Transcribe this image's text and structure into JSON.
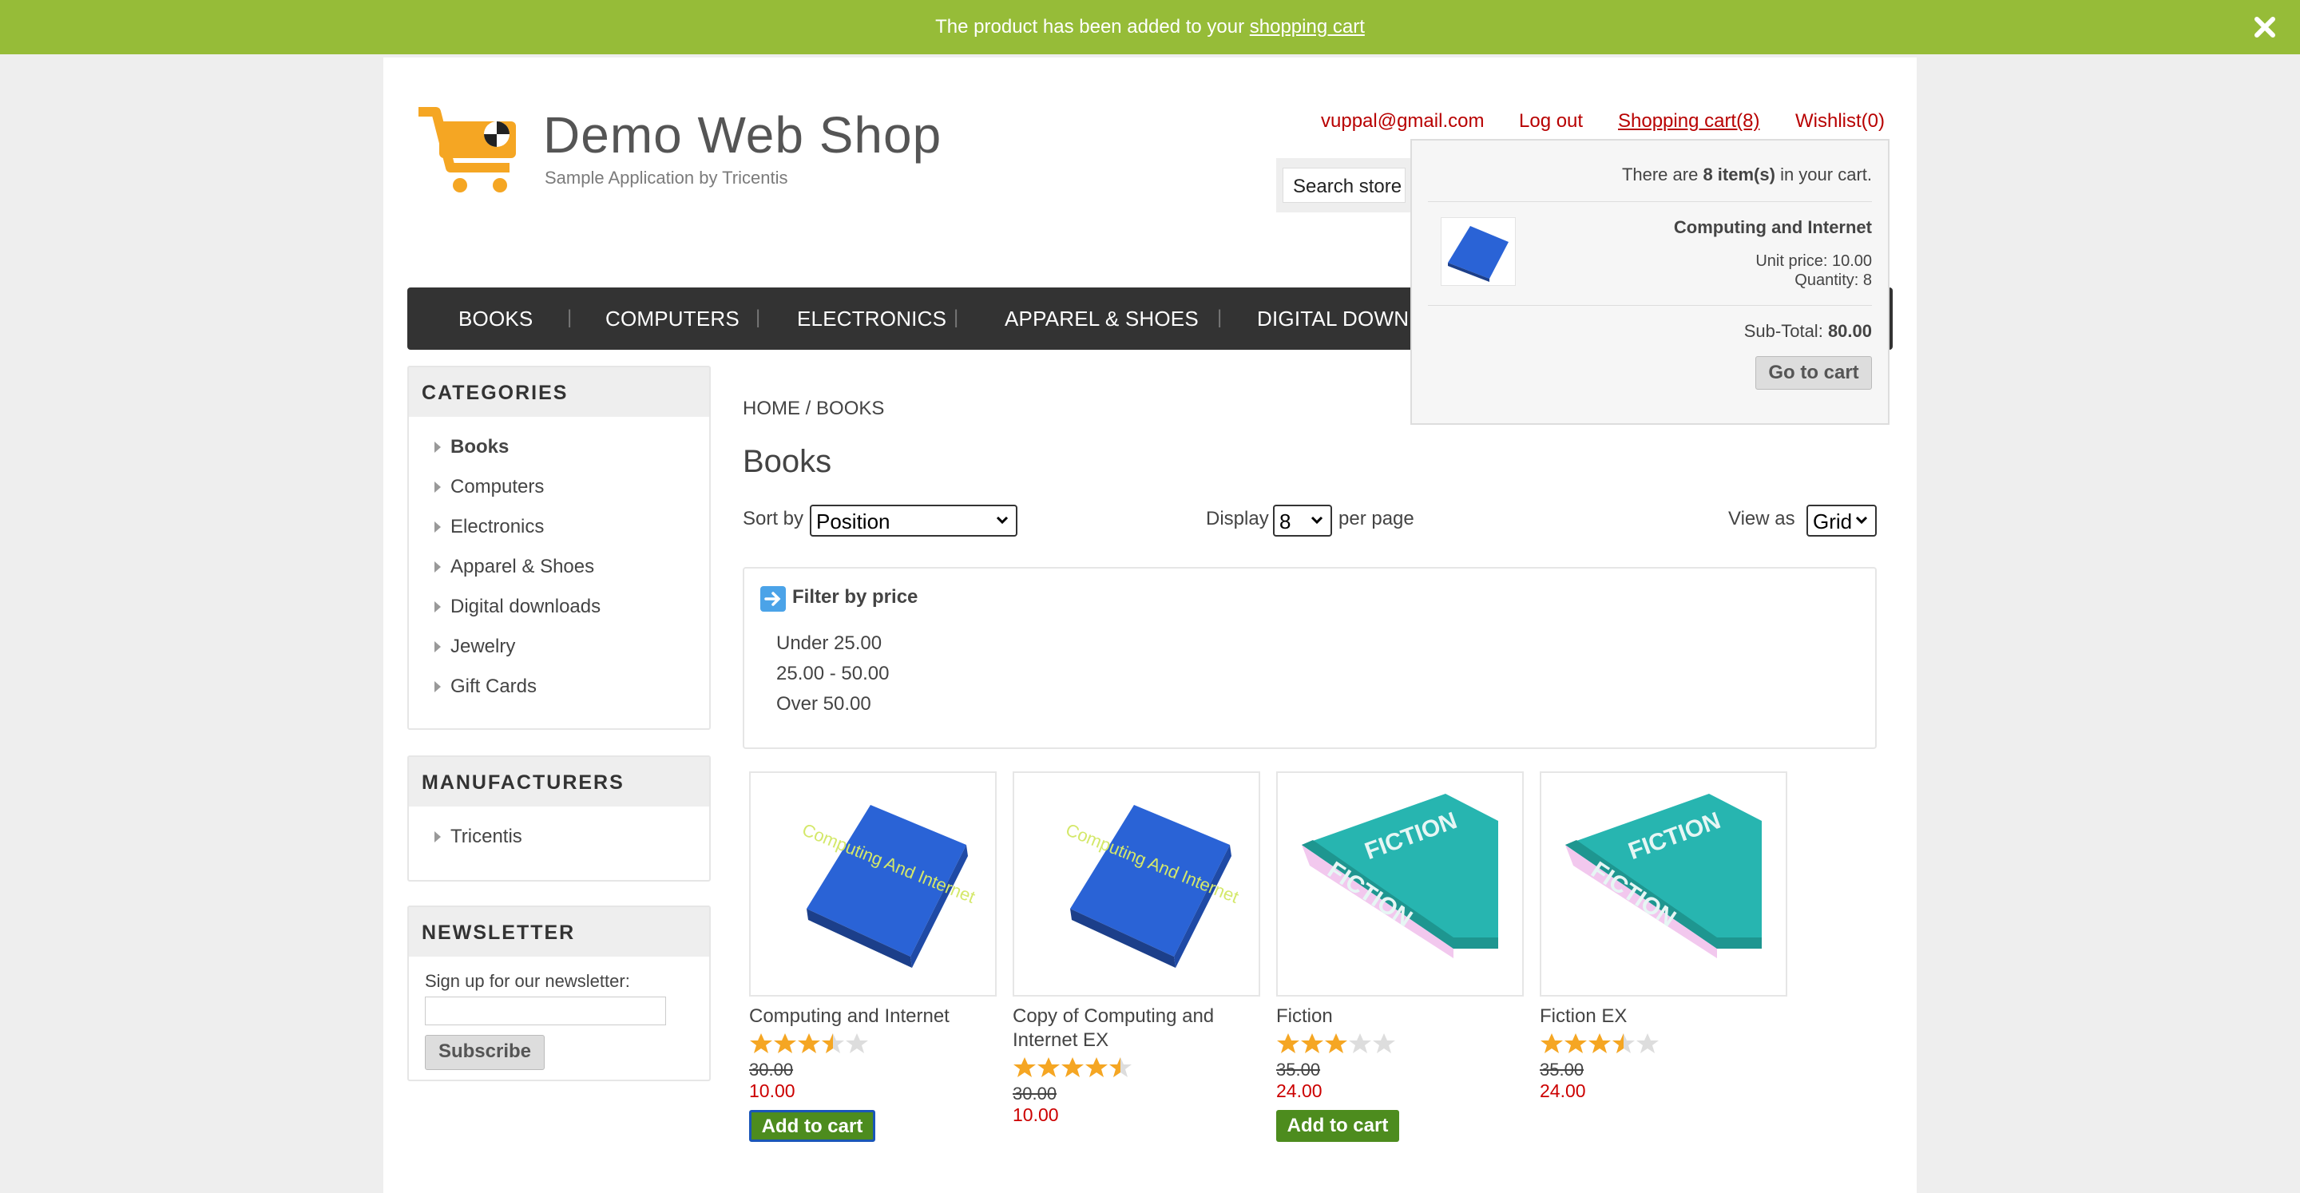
{
  "notification": {
    "message": "The product has been added to your",
    "link": "shopping cart"
  },
  "header": {
    "logo_title": "Demo Web Shop",
    "logo_subtitle": "Sample Application by Tricentis",
    "email": "vuppal@gmail.com",
    "logout": "Log out",
    "cart": "Shopping cart(8)",
    "wishlist": "Wishlist(0)",
    "search_placeholder": "Search store"
  },
  "menu": [
    "BOOKS",
    "COMPUTERS",
    "ELECTRONICS",
    "APPAREL & SHOES",
    "DIGITAL DOWN"
  ],
  "categories": {
    "title": "CATEGORIES",
    "items": [
      "Books",
      "Computers",
      "Electronics",
      "Apparel & Shoes",
      "Digital downloads",
      "Jewelry",
      "Gift Cards"
    ]
  },
  "manufacturers": {
    "title": "MANUFACTURERS",
    "items": [
      "Tricentis"
    ]
  },
  "newsletter": {
    "title": "NEWSLETTER",
    "label": "Sign up for our newsletter:",
    "button": "Subscribe"
  },
  "breadcrumb": {
    "home": "HOME",
    "sep": "/",
    "current": "BOOKS"
  },
  "page_title": "Books",
  "controls": {
    "sort_label": "Sort by",
    "sort_value": "Position",
    "display_label": "Display",
    "display_value": "8",
    "per_page": "per page",
    "view_label": "View as",
    "view_value": "Grid"
  },
  "filter": {
    "title": "Filter by price",
    "ranges": [
      "Under 25.00",
      "25.00 - 50.00",
      "Over 50.00"
    ]
  },
  "products": [
    {
      "title_line1": "Computing and Internet",
      "title_line2": "",
      "old_price": "30.00",
      "price": "10.00",
      "rating": 3.5,
      "add_label": "Add to cart",
      "cover": "computing",
      "cover_text": "Computing And Internet"
    },
    {
      "title_line1": "Copy of Computing and",
      "title_line2": "Internet EX",
      "old_price": "30.00",
      "price": "10.00",
      "rating": 4.5,
      "add_label": "",
      "cover": "computing",
      "cover_text": "Computing And Internet"
    },
    {
      "title_line1": "Fiction",
      "title_line2": "",
      "old_price": "35.00",
      "price": "24.00",
      "rating": 3,
      "add_label": "Add to cart",
      "cover": "fiction",
      "cover_text": "FICTION"
    },
    {
      "title_line1": "Fiction EX",
      "title_line2": "",
      "old_price": "35.00",
      "price": "24.00",
      "rating": 3.5,
      "add_label": "",
      "cover": "fiction",
      "cover_text": "FICTION"
    }
  ],
  "flyout": {
    "summary_pre": "There are",
    "summary_count": "8 item(s)",
    "summary_post": "in your cart.",
    "item_name": "Computing and Internet",
    "unit_price": "Unit price: 10.00",
    "quantity": "Quantity: 8",
    "subtotal_label": "Sub-Total:",
    "subtotal_value": "80.00",
    "button": "Go to cart"
  },
  "colors": {
    "notification_bg": "#96bc38",
    "menu_bg": "#333333",
    "link_red": "#b80000",
    "price_red": "#cc0000",
    "button_green": "#4d8c1e",
    "star": "#f5a623"
  }
}
